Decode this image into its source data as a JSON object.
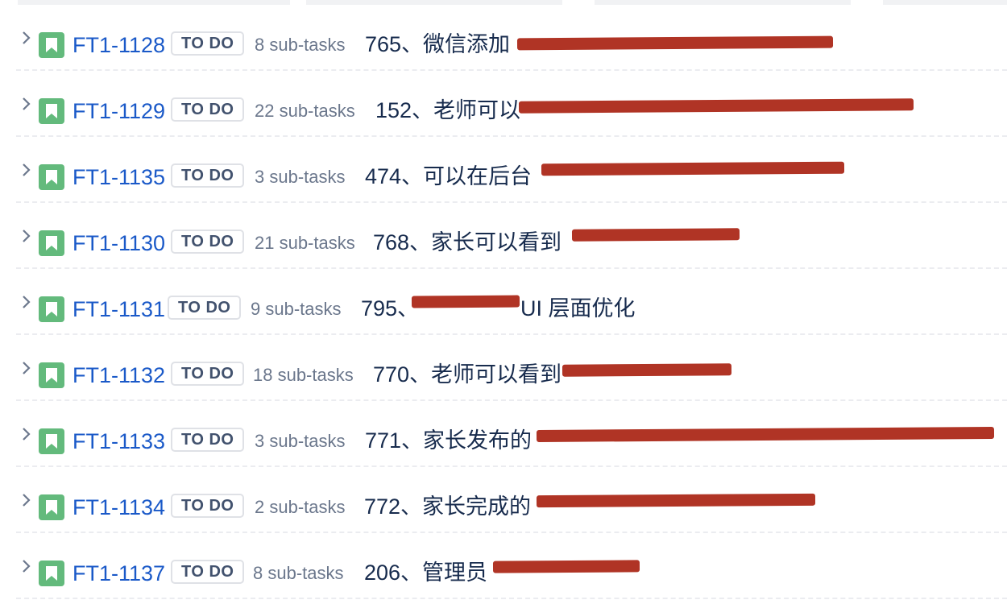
{
  "issues": [
    {
      "key": "FT1-1128",
      "status": "TO DO",
      "subtasks": "8 sub-tasks",
      "summary": "765、微信添加"
    },
    {
      "key": "FT1-1129",
      "status": "TO DO",
      "subtasks": "22 sub-tasks",
      "summary": "152、老师可以"
    },
    {
      "key": "FT1-1135",
      "status": "TO DO",
      "subtasks": "3 sub-tasks",
      "summary": "474、可以在后台"
    },
    {
      "key": "FT1-1130",
      "status": "TO DO",
      "subtasks": "21 sub-tasks",
      "summary": "768、家长可以看到"
    },
    {
      "key": "FT1-1131",
      "status": "TO DO",
      "subtasks": "9 sub-tasks",
      "summary": "795、",
      "summary_tail": "UI 层面优化"
    },
    {
      "key": "FT1-1132",
      "status": "TO DO",
      "subtasks": "18 sub-tasks",
      "summary": "770、老师可以看到"
    },
    {
      "key": "FT1-1133",
      "status": "TO DO",
      "subtasks": "3 sub-tasks",
      "summary": "771、家长发布的"
    },
    {
      "key": "FT1-1134",
      "status": "TO DO",
      "subtasks": "2 sub-tasks",
      "summary": "772、家长完成的"
    },
    {
      "key": "FT1-1137",
      "status": "TO DO",
      "subtasks": "8 sub-tasks",
      "summary": "206、管理员"
    }
  ],
  "colors": {
    "story_icon": "#63ba7c",
    "issue_key": "#1a59c8",
    "redaction": "#b03425"
  },
  "icons": {
    "expand": "chevron-right-icon",
    "issue_type": "story-bookmark-icon"
  }
}
